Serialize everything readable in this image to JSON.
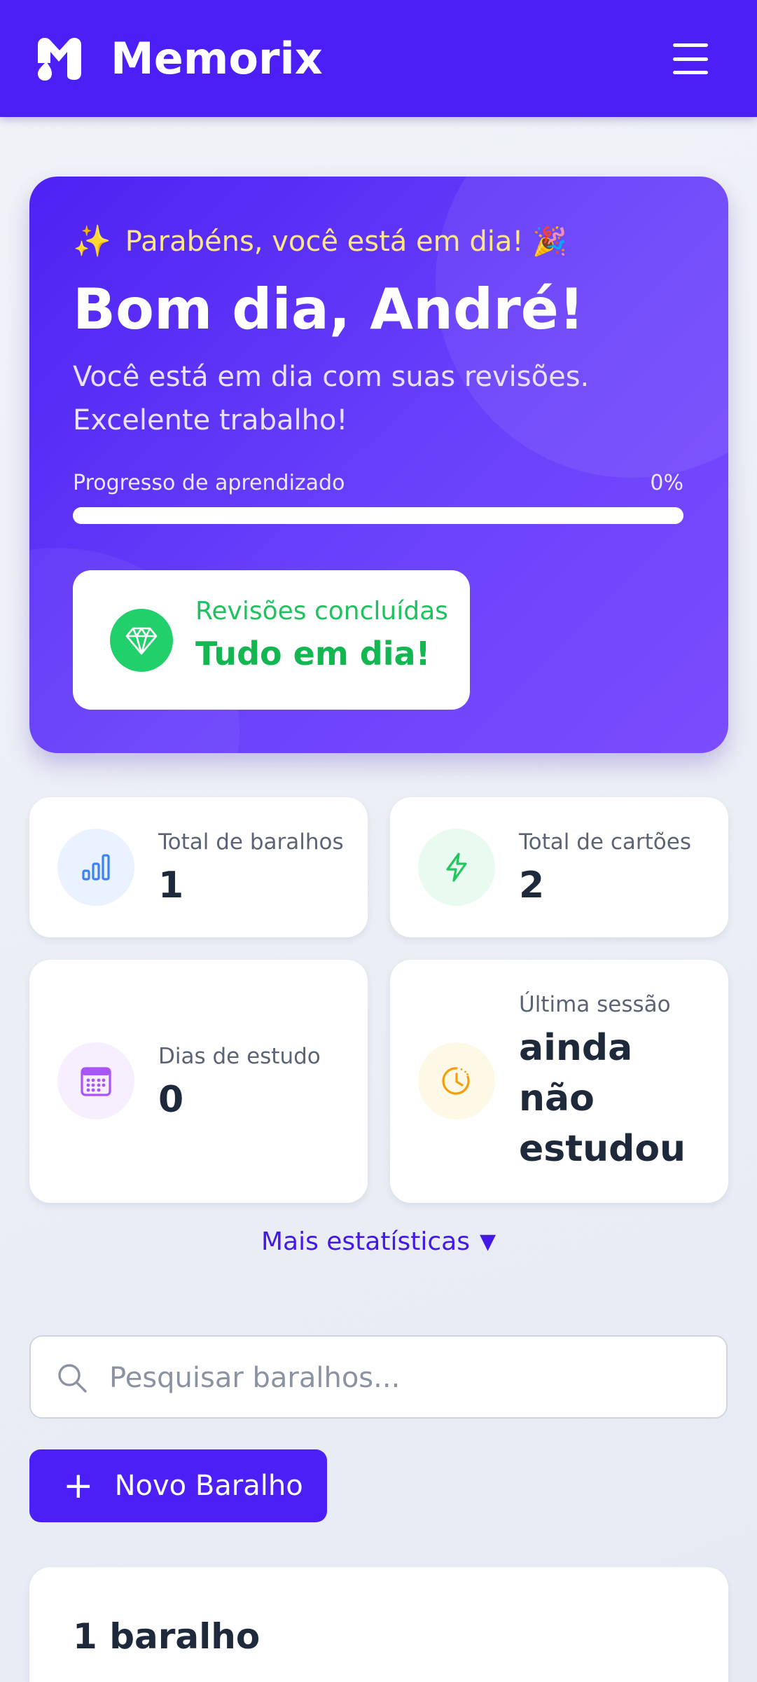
{
  "app": {
    "name": "Memorix"
  },
  "colors": {
    "brand": "#4b1ff5",
    "success": "#22c55e"
  },
  "hero": {
    "congrats": "Parabéns, você está em dia!",
    "congrats_emoji": "🎉",
    "sparkle": "✨",
    "greeting": "Bom dia, André!",
    "subtext": "Você está em dia com suas revisões. Excelente trabalho!",
    "progress_label": "Progresso de aprendizado",
    "progress_percent_text": "0%",
    "progress_value": 0,
    "reviews_title": "Revisões concluídas",
    "reviews_value": "Tudo em dia!"
  },
  "stats": [
    {
      "label": "Total de baralhos",
      "value": "1",
      "icon": "bar-chart-icon"
    },
    {
      "label": "Total de cartões",
      "value": "2",
      "icon": "lightning-icon"
    },
    {
      "label": "Dias de estudo",
      "value": "0",
      "icon": "calendar-icon"
    },
    {
      "label": "Última sessão",
      "value": "ainda não estudou",
      "icon": "clock-icon"
    }
  ],
  "more_stats": {
    "label": "Mais estatísticas",
    "icon": "caret-down-icon"
  },
  "search": {
    "placeholder": "Pesquisar baralhos..."
  },
  "new_deck": {
    "label": "Novo Baralho",
    "plus": "+"
  },
  "deck_list": {
    "count_label": "1 baralho"
  }
}
